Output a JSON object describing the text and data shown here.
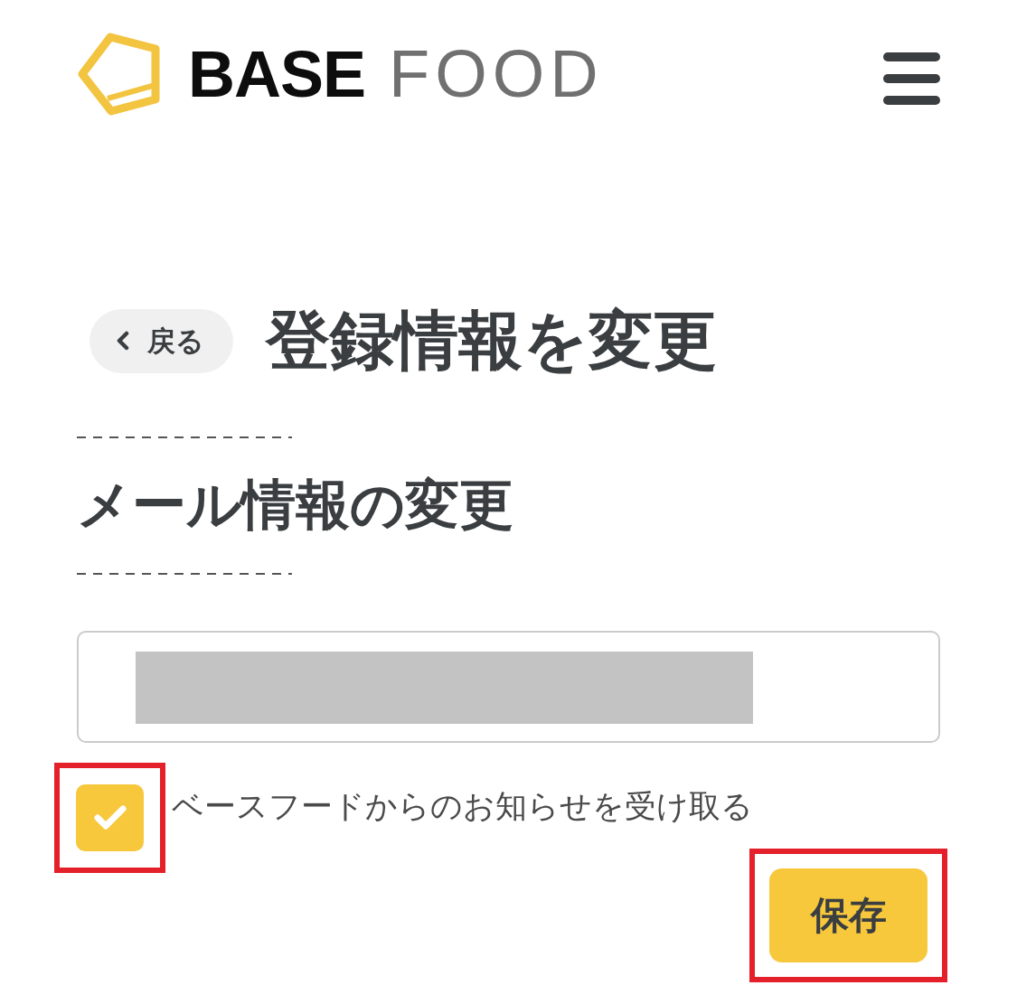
{
  "header": {
    "logo": {
      "bold_text": "BASE",
      "light_text": "FOOD"
    }
  },
  "back_button": {
    "label": "戻る"
  },
  "title": "登録情報を変更",
  "section": {
    "heading": "メール情報の変更",
    "email_field": {
      "redacted": true
    },
    "newsletter_checkbox": {
      "label": "ベースフードからのお知らせを受け取る",
      "checked": true,
      "highlighted": true
    },
    "save_button": {
      "label": "保存",
      "highlighted": true
    }
  }
}
